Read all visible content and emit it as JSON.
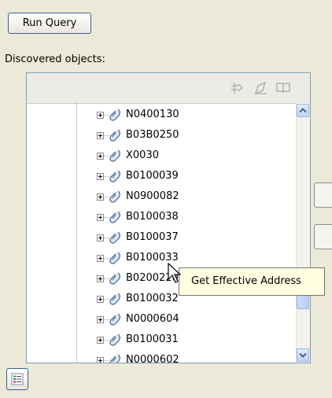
{
  "run_query": {
    "label": "Run Query"
  },
  "discovered": {
    "label": "Discovered objects:",
    "toolbar_icons": [
      "move-arrows-icon",
      "edit-pencil-icon",
      "open-book-icon"
    ],
    "tree_items": [
      {
        "label": "N0400130"
      },
      {
        "label": "B03B0250"
      },
      {
        "label": "X0030"
      },
      {
        "label": "B0100039"
      },
      {
        "label": "N0900082"
      },
      {
        "label": "B0100038"
      },
      {
        "label": "B0100037"
      },
      {
        "label": "B0100033"
      },
      {
        "label": "B0200220"
      },
      {
        "label": "B0100032"
      },
      {
        "label": "N0000604"
      },
      {
        "label": "B0100031"
      },
      {
        "label": "N0000602"
      }
    ]
  },
  "tooltip": {
    "text": "Get Effective Address"
  },
  "colors": {
    "window_bg": "#ece9d8",
    "tooltip_bg": "#ffffe1",
    "scroll_blue": "#c1d3fb",
    "button_border": "#3a5f8f"
  }
}
